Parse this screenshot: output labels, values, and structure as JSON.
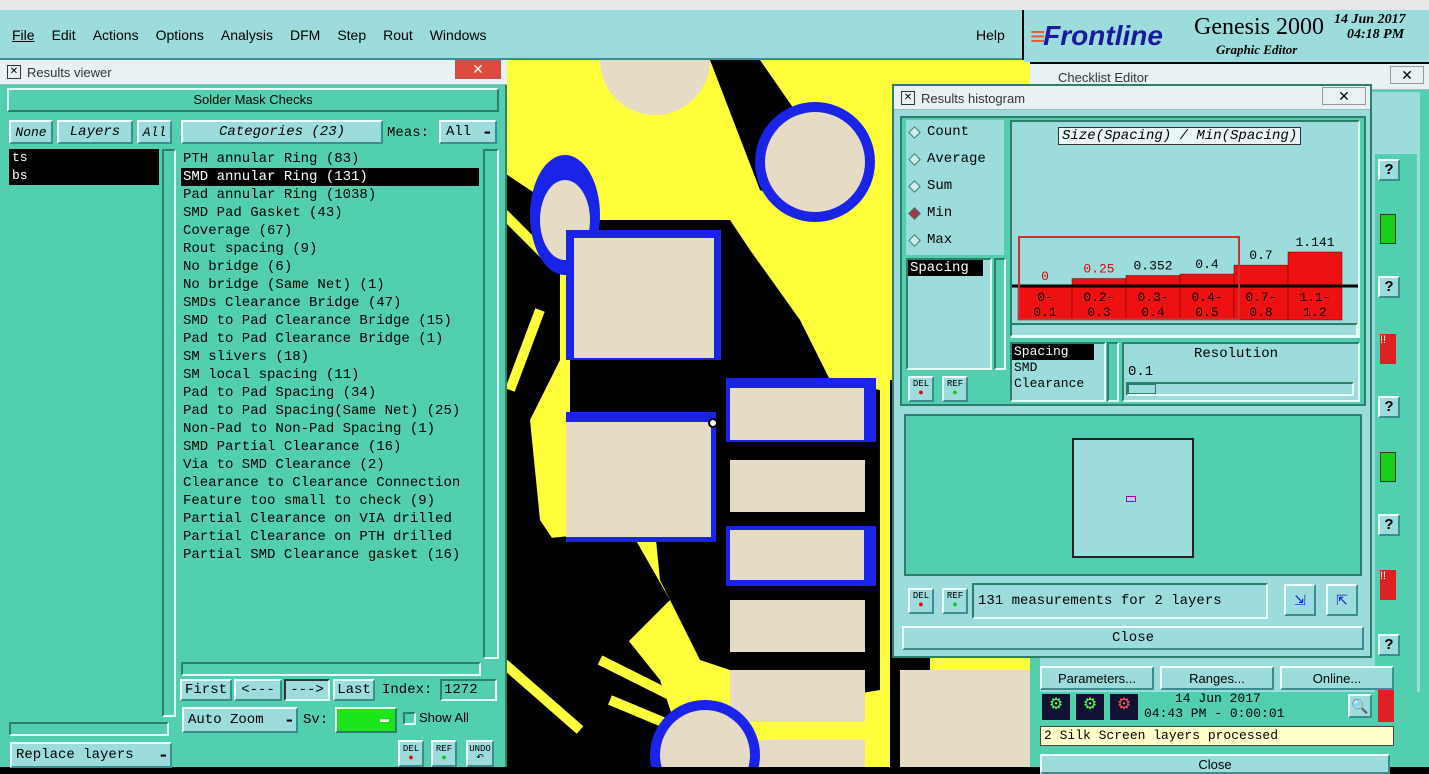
{
  "menubar": {
    "items": [
      "File",
      "Edit",
      "Actions",
      "Options",
      "Analysis",
      "DFM",
      "Step",
      "Rout",
      "Windows"
    ],
    "help": "Help"
  },
  "brand": {
    "logo": "Frontline",
    "product": "Genesis 2000",
    "subtitle": "Graphic Editor",
    "date": "14 Jun 2017",
    "time": "04:18 PM"
  },
  "results_viewer": {
    "title": "Results viewer",
    "header": "Solder Mask Checks",
    "none": "None",
    "layers_btn": "Layers",
    "all": "All",
    "categories": "Categories (23)",
    "meas_label": "Meas:",
    "meas_value": "All",
    "layers": [
      "ts",
      "bs"
    ],
    "selected_category": 1,
    "category_items": [
      "PTH annular Ring (83)",
      "SMD annular Ring (131)",
      "Pad annular Ring (1038)",
      "SMD Pad Gasket (43)",
      "Coverage (67)",
      "Rout spacing (9)",
      "No bridge (6)",
      "No bridge (Same Net) (1)",
      "SMDs Clearance Bridge (47)",
      "SMD to Pad Clearance Bridge (15)",
      "Pad to Pad Clearance Bridge (1)",
      "SM slivers (18)",
      "SM local spacing (11)",
      "Pad to Pad Spacing (34)",
      "Pad to Pad Spacing(Same Net) (25)",
      "Non-Pad to Non-Pad Spacing (1)",
      "SMD Partial Clearance (16)",
      "Via to SMD Clearance (2)",
      "Clearance to Clearance Connection",
      "Feature too small to check (9)",
      "Partial Clearance on VIA drilled",
      "Partial Clearance on PTH drilled",
      "Partial SMD Clearance gasket (16)"
    ],
    "first": "First",
    "prev": "<---",
    "next": "--->",
    "last": "Last",
    "index_label": "Index:",
    "index_value": "1272",
    "auto_zoom": "Auto Zoom",
    "sv": "Sv:",
    "show_all": "Show All",
    "replace_layers": "Replace layers",
    "del": "DEL",
    "ref": "REF",
    "undo": "UNDO"
  },
  "histogram": {
    "title": "Results histogram",
    "modes": [
      "Count",
      "Average",
      "Sum",
      "Min",
      "Max"
    ],
    "selected_mode": 3,
    "chart_title": "Size(Spacing) / Min(Spacing)",
    "measure": "Spacing",
    "layers_list": [
      "Spacing",
      "SMD",
      "Clearance"
    ],
    "resolution_label": "Resolution",
    "resolution_value": "0.1",
    "status": "131 measurements for 2 layers",
    "close": "Close",
    "del": "DEL",
    "ref": "REF"
  },
  "chart_data": {
    "type": "bar",
    "title": "Size(Spacing) / Min(Spacing)",
    "categories": [
      "0-0.1",
      "0.2-0.3",
      "0.3-0.4",
      "0.4-0.5",
      "0.7-0.8",
      "1.1-1.2"
    ],
    "cat_top": [
      "0-",
      "0.2-",
      "0.3-",
      "0.4-",
      "0.7-",
      "1.1-"
    ],
    "cat_bottom": [
      "0.1",
      "0.3",
      "0.4",
      "0.5",
      "0.8",
      "1.2"
    ],
    "values": [
      0,
      0.25,
      0.352,
      0.4,
      0.7,
      1.141
    ],
    "value_labels": [
      "0",
      "0.25",
      "0.352",
      "0.4",
      "0.7",
      "1.141"
    ],
    "label_colors": [
      "#e00000",
      "#e00000",
      "#000000",
      "#000000",
      "#000000",
      "#000000"
    ],
    "bar_color": "#ee1111"
  },
  "checklist": {
    "title": "Checklist Editor",
    "parameters": "Parameters...",
    "ranges": "Ranges...",
    "online": "Online...",
    "date": "14 Jun 2017",
    "time": "04:43 PM - 0:00:01",
    "status": "2 Silk Screen layers processed",
    "close": "Close"
  }
}
